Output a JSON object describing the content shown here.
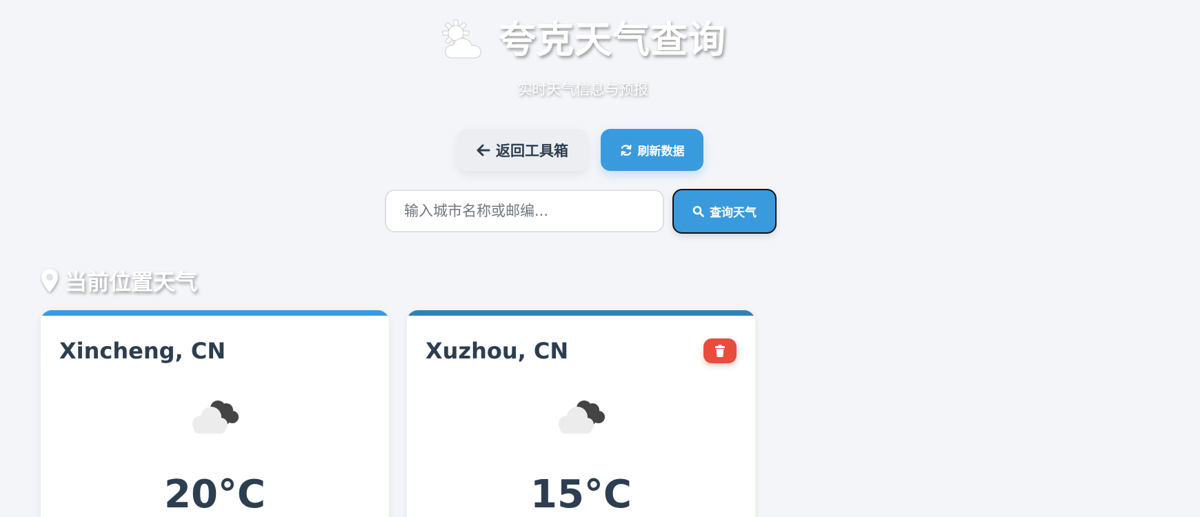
{
  "header": {
    "title": "夸克天气查询",
    "subtitle": "实时天气信息与预报",
    "logo_icon": "sun-behind-cloud-icon"
  },
  "actions": {
    "back_label": "返回工具箱",
    "back_icon": "arrow-left-icon",
    "refresh_label": "刷新数据",
    "refresh_icon": "sync-icon"
  },
  "search": {
    "placeholder": "输入城市名称或邮编...",
    "value": "",
    "button_label": "查询天气",
    "button_icon": "search-icon"
  },
  "section": {
    "title": "当前位置天气",
    "icon": "map-pin-icon"
  },
  "cards": [
    {
      "city": "Xincheng, CN",
      "temperature": "20°C",
      "weather_icon": "cloudy-icon",
      "accent_color": "#3a9ade",
      "deletable": false
    },
    {
      "city": "Xuzhou, CN",
      "temperature": "15°C",
      "weather_icon": "cloudy-icon",
      "accent_color": "#2f80b9",
      "deletable": true,
      "delete_icon": "trash-icon"
    }
  ],
  "colors": {
    "primary": "#3a9ade",
    "danger": "#e74c3c",
    "text_dark": "#2c3e50",
    "background": "#f4f5f9"
  }
}
